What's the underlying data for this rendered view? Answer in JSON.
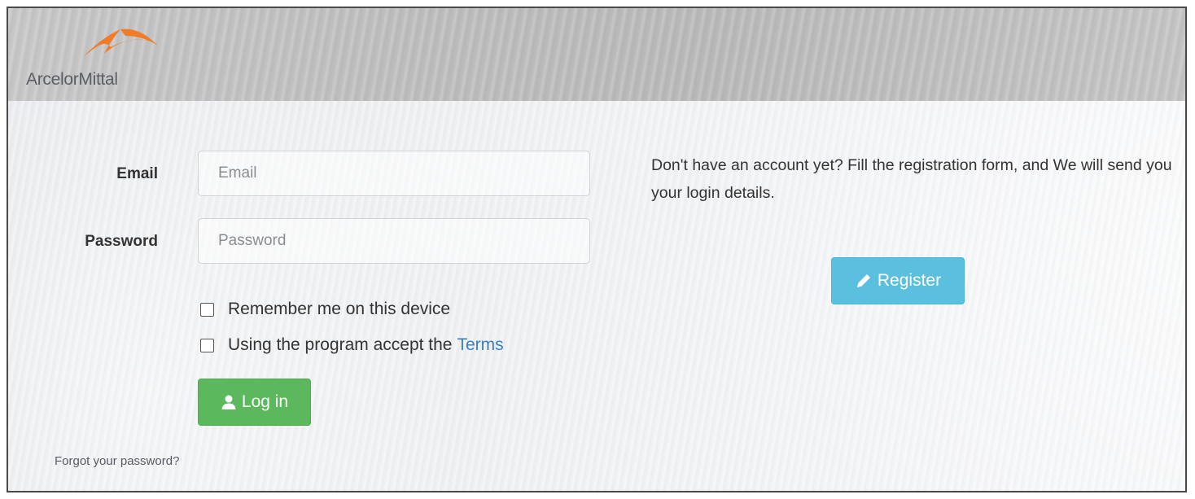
{
  "header": {
    "logo_text": "ArcelorMittal",
    "logo_icon": "arcelormittal-swoosh-logo",
    "brand_color": "#f07c2a"
  },
  "login_form": {
    "email_label": "Email",
    "email_placeholder": "Email",
    "email_value": "",
    "password_label": "Password",
    "password_placeholder": "Password",
    "password_value": "",
    "remember_label": "Remember me on this device",
    "remember_checked": false,
    "terms_prefix": "Using the program accept the",
    "terms_link": "Terms",
    "terms_checked": false,
    "login_button": "Log in",
    "login_icon": "user-icon",
    "login_color": "#5cb85c",
    "forgot_link": "Forgot your password?"
  },
  "register_panel": {
    "info_text": "Don't have an account yet? Fill the registration form, and We will send you your login details.",
    "register_button": "Register",
    "register_icon": "pencil-icon",
    "register_color": "#5bc0de"
  }
}
